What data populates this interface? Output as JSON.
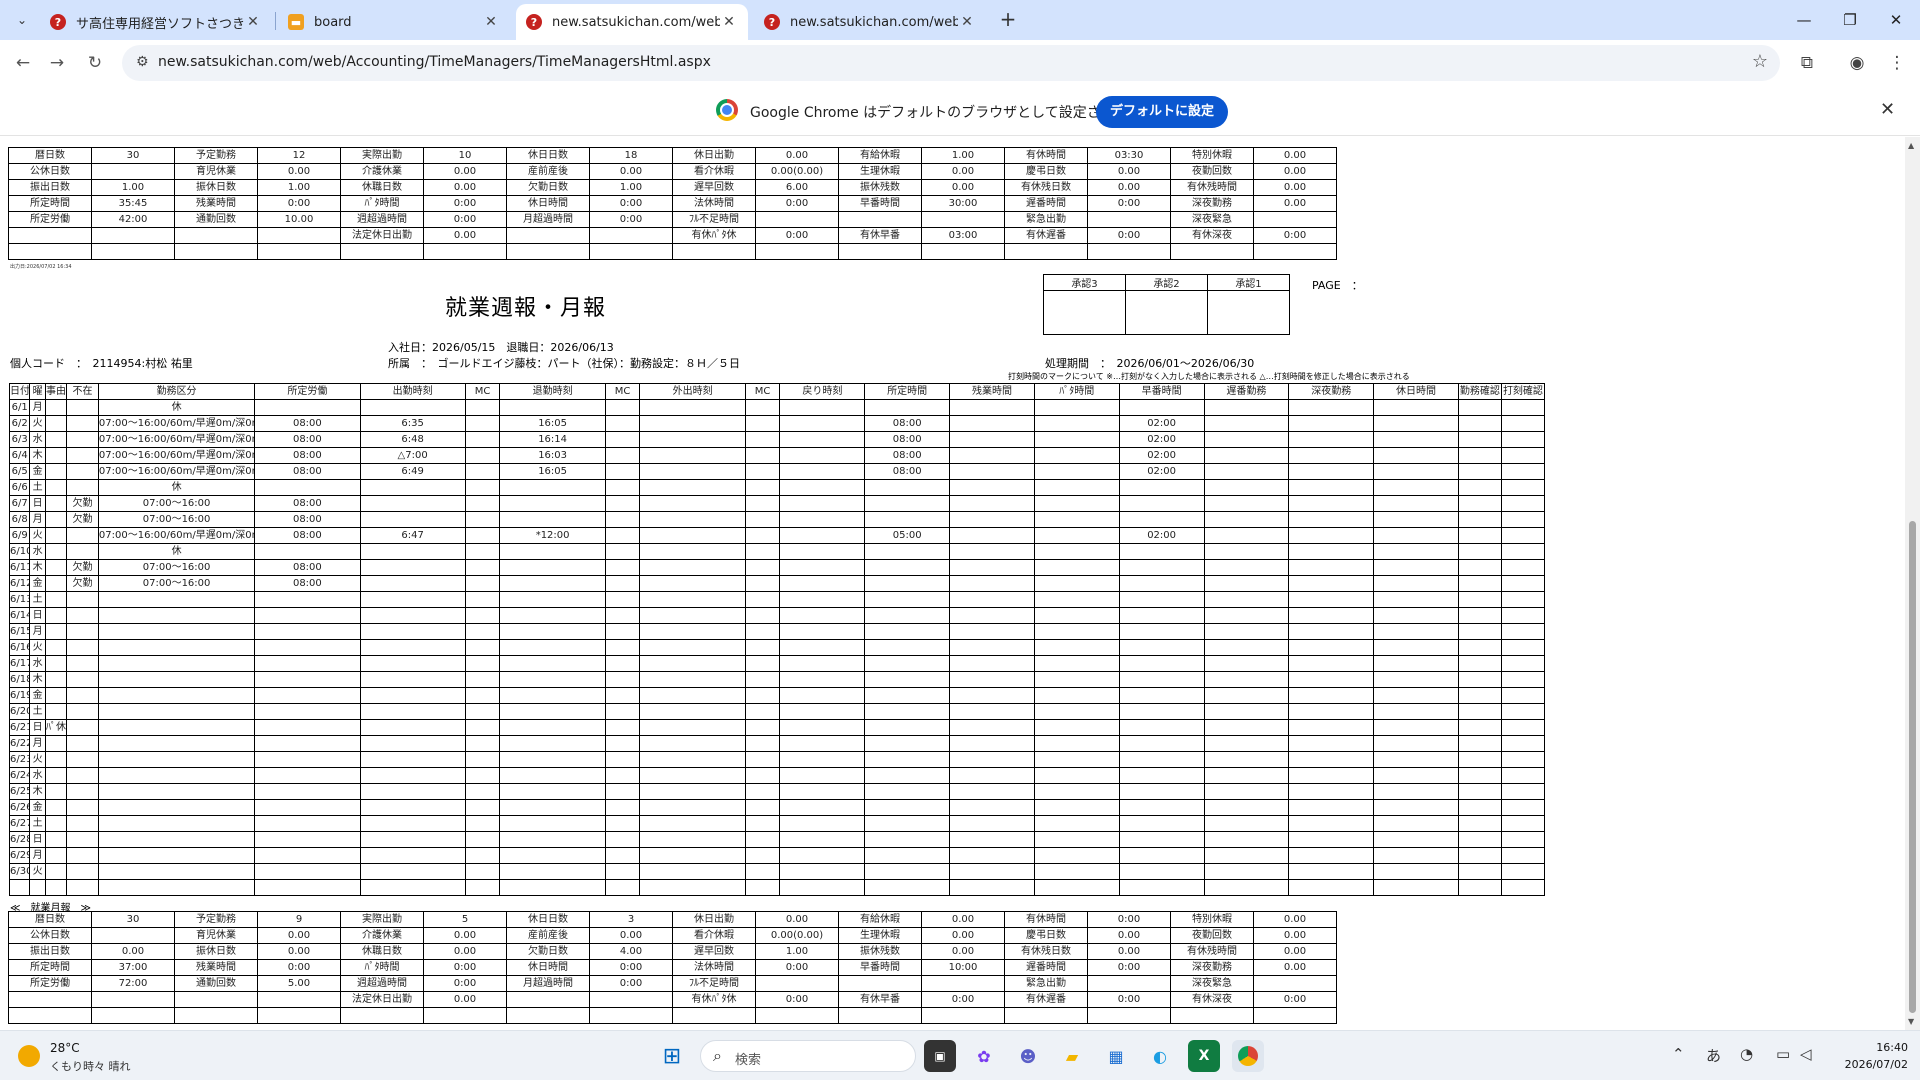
{
  "browser": {
    "tabs": [
      {
        "title": "サ高住専用経営ソフトさつきちゃん",
        "favicon": "question-icon"
      },
      {
        "title": "board",
        "favicon": "board-icon"
      },
      {
        "title": "new.satsukichan.com/web/Acco",
        "favicon": "question-icon"
      },
      {
        "title": "new.satsukichan.com/web/Acco",
        "favicon": "question-icon"
      }
    ],
    "url": "new.satsukichan.com/web/Accounting/TimeManagers/TimeManagersHtml.aspx",
    "infobar_message": "Google Chrome はデフォルトのブラウザとして設定されていません",
    "infobar_button": "デフォルトに設定"
  },
  "top_summary": {
    "rows": [
      [
        "暦日数",
        "30",
        "予定勤務",
        "12",
        "実際出勤",
        "10",
        "休日日数",
        "18",
        "休日出勤",
        "0.00",
        "有給休暇",
        "1.00",
        "有休時間",
        "03:30",
        "特別休暇",
        "0.00"
      ],
      [
        "公休日数",
        "",
        "育児休業",
        "0.00",
        "介護休業",
        "0.00",
        "産前産後",
        "0.00",
        "看介休暇",
        "0.00(0.00)",
        "生理休暇",
        "0.00",
        "慶弔日数",
        "0.00",
        "夜勤回数",
        "0.00"
      ],
      [
        "振出日数",
        "1.00",
        "振休日数",
        "1.00",
        "休職日数",
        "0.00",
        "欠勤日数",
        "1.00",
        "遅早回数",
        "6.00",
        "振休残数",
        "0.00",
        "有休残日数",
        "0.00",
        "有休残時間",
        "0.00"
      ],
      [
        "所定時間",
        "35:45",
        "残業時間",
        "0:00",
        "ﾊﾟﾀ時間",
        "0:00",
        "休日時間",
        "0:00",
        "法休時間",
        "0:00",
        "早番時間",
        "30:00",
        "遅番時間",
        "0:00",
        "深夜勤務",
        "0.00"
      ],
      [
        "所定労働",
        "42:00",
        "通勤回数",
        "10.00",
        "週超過時間",
        "0:00",
        "月超過時間",
        "0:00",
        "ﾌﾙ不足時間",
        "",
        "",
        "",
        "緊急出勤",
        "",
        "深夜緊急",
        ""
      ],
      [
        "",
        "",
        "",
        "",
        "法定休日出勤",
        "0.00",
        "",
        "",
        "有休ﾊﾟﾀ休",
        "0:00",
        "有休早番",
        "03:00",
        "有休遅番",
        "0:00",
        "有休深夜",
        "0:00"
      ],
      [
        "",
        "",
        "",
        "",
        "",
        "",
        "",
        "",
        "",
        "",
        "",
        "",
        "",
        "",
        "",
        ""
      ]
    ]
  },
  "report": {
    "print_stamp": "出力日:2026/07/02 16:34",
    "title": "就業週報・月報",
    "approvals": [
      "承認3",
      "承認2",
      "承認1"
    ],
    "page_label": "PAGE　：",
    "hire_info": "入社日：2026/05/15　退職日：2026/06/13",
    "employee_code": "個人コード　：　2114954:村松 祐里",
    "affiliation": "所属　：　ゴールドエイジ藤枝：パート（社保）：勤務設定：８Ｈ／５日",
    "period": "処理期間　：　2026/06/01〜2026/06/30",
    "mark_note": "打刻時間のマークについて ※…打刻がなく入力した場合に表示される △…打刻時間を修正した場合に表示される"
  },
  "daily": {
    "headers": [
      "日付",
      "曜",
      "事由",
      "不在",
      "勤務区分",
      "所定労働",
      "出勤時刻",
      "MC",
      "退勤時刻",
      "MC",
      "外出時刻",
      "MC",
      "戻り時刻",
      "所定時間",
      "残業時間",
      "ﾊﾟﾀ時間",
      "早番時間",
      "遅番勤務",
      "深夜勤務",
      "休日時間",
      "勤務確認",
      "打刻確認"
    ],
    "rows": [
      [
        "6/1",
        "月",
        "",
        "",
        "休",
        "",
        "",
        "",
        "",
        "",
        "",
        "",
        "",
        "",
        "",
        "",
        "",
        "",
        "",
        "",
        "",
        ""
      ],
      [
        "6/2",
        "火",
        "",
        "",
        "07:00〜16:00/60m/早遅0m/深0m",
        "08:00",
        "6:35",
        "",
        "16:05",
        "",
        "",
        "",
        "",
        "08:00",
        "",
        "",
        "02:00",
        "",
        "",
        "",
        "",
        ""
      ],
      [
        "6/3",
        "水",
        "",
        "",
        "07:00〜16:00/60m/早遅0m/深0m",
        "08:00",
        "6:48",
        "",
        "16:14",
        "",
        "",
        "",
        "",
        "08:00",
        "",
        "",
        "02:00",
        "",
        "",
        "",
        "",
        ""
      ],
      [
        "6/4",
        "木",
        "",
        "",
        "07:00〜16:00/60m/早遅0m/深0m",
        "08:00",
        "△7:00",
        "",
        "16:03",
        "",
        "",
        "",
        "",
        "08:00",
        "",
        "",
        "02:00",
        "",
        "",
        "",
        "",
        ""
      ],
      [
        "6/5",
        "金",
        "",
        "",
        "07:00〜16:00/60m/早遅0m/深0m",
        "08:00",
        "6:49",
        "",
        "16:05",
        "",
        "",
        "",
        "",
        "08:00",
        "",
        "",
        "02:00",
        "",
        "",
        "",
        "",
        ""
      ],
      [
        "6/6",
        "土",
        "",
        "",
        "休",
        "",
        "",
        "",
        "",
        "",
        "",
        "",
        "",
        "",
        "",
        "",
        "",
        "",
        "",
        "",
        "",
        ""
      ],
      [
        "6/7",
        "日",
        "",
        "欠勤",
        "07:00〜16:00",
        "08:00",
        "",
        "",
        "",
        "",
        "",
        "",
        "",
        "",
        "",
        "",
        "",
        "",
        "",
        "",
        "",
        ""
      ],
      [
        "6/8",
        "月",
        "",
        "欠勤",
        "07:00〜16:00",
        "08:00",
        "",
        "",
        "",
        "",
        "",
        "",
        "",
        "",
        "",
        "",
        "",
        "",
        "",
        "",
        "",
        ""
      ],
      [
        "6/9",
        "火",
        "",
        "",
        "07:00〜16:00/60m/早遅0m/深0m",
        "08:00",
        "6:47",
        "",
        "*12:00",
        "",
        "",
        "",
        "",
        "05:00",
        "",
        "",
        "02:00",
        "",
        "",
        "",
        "",
        ""
      ],
      [
        "6/10",
        "水",
        "",
        "",
        "休",
        "",
        "",
        "",
        "",
        "",
        "",
        "",
        "",
        "",
        "",
        "",
        "",
        "",
        "",
        "",
        "",
        ""
      ],
      [
        "6/11",
        "木",
        "",
        "欠勤",
        "07:00〜16:00",
        "08:00",
        "",
        "",
        "",
        "",
        "",
        "",
        "",
        "",
        "",
        "",
        "",
        "",
        "",
        "",
        "",
        ""
      ],
      [
        "6/12",
        "金",
        "",
        "欠勤",
        "07:00〜16:00",
        "08:00",
        "",
        "",
        "",
        "",
        "",
        "",
        "",
        "",
        "",
        "",
        "",
        "",
        "",
        "",
        "",
        ""
      ],
      [
        "6/13",
        "土",
        "",
        "",
        "",
        "",
        "",
        "",
        "",
        "",
        "",
        "",
        "",
        "",
        "",
        "",
        "",
        "",
        "",
        "",
        "",
        ""
      ],
      [
        "6/14",
        "日",
        "",
        "",
        "",
        "",
        "",
        "",
        "",
        "",
        "",
        "",
        "",
        "",
        "",
        "",
        "",
        "",
        "",
        "",
        "",
        ""
      ],
      [
        "6/15",
        "月",
        "",
        "",
        "",
        "",
        "",
        "",
        "",
        "",
        "",
        "",
        "",
        "",
        "",
        "",
        "",
        "",
        "",
        "",
        "",
        ""
      ],
      [
        "6/16",
        "火",
        "",
        "",
        "",
        "",
        "",
        "",
        "",
        "",
        "",
        "",
        "",
        "",
        "",
        "",
        "",
        "",
        "",
        "",
        "",
        ""
      ],
      [
        "6/17",
        "水",
        "",
        "",
        "",
        "",
        "",
        "",
        "",
        "",
        "",
        "",
        "",
        "",
        "",
        "",
        "",
        "",
        "",
        "",
        "",
        ""
      ],
      [
        "6/18",
        "木",
        "",
        "",
        "",
        "",
        "",
        "",
        "",
        "",
        "",
        "",
        "",
        "",
        "",
        "",
        "",
        "",
        "",
        "",
        "",
        ""
      ],
      [
        "6/19",
        "金",
        "",
        "",
        "",
        "",
        "",
        "",
        "",
        "",
        "",
        "",
        "",
        "",
        "",
        "",
        "",
        "",
        "",
        "",
        "",
        ""
      ],
      [
        "6/20",
        "土",
        "",
        "",
        "",
        "",
        "",
        "",
        "",
        "",
        "",
        "",
        "",
        "",
        "",
        "",
        "",
        "",
        "",
        "",
        "",
        ""
      ],
      [
        "6/21",
        "日",
        "ﾊﾟ休",
        "",
        "",
        "",
        "",
        "",
        "",
        "",
        "",
        "",
        "",
        "",
        "",
        "",
        "",
        "",
        "",
        "",
        "",
        ""
      ],
      [
        "6/22",
        "月",
        "",
        "",
        "",
        "",
        "",
        "",
        "",
        "",
        "",
        "",
        "",
        "",
        "",
        "",
        "",
        "",
        "",
        "",
        "",
        ""
      ],
      [
        "6/23",
        "火",
        "",
        "",
        "",
        "",
        "",
        "",
        "",
        "",
        "",
        "",
        "",
        "",
        "",
        "",
        "",
        "",
        "",
        "",
        "",
        ""
      ],
      [
        "6/24",
        "水",
        "",
        "",
        "",
        "",
        "",
        "",
        "",
        "",
        "",
        "",
        "",
        "",
        "",
        "",
        "",
        "",
        "",
        "",
        "",
        ""
      ],
      [
        "6/25",
        "木",
        "",
        "",
        "",
        "",
        "",
        "",
        "",
        "",
        "",
        "",
        "",
        "",
        "",
        "",
        "",
        "",
        "",
        "",
        "",
        ""
      ],
      [
        "6/26",
        "金",
        "",
        "",
        "",
        "",
        "",
        "",
        "",
        "",
        "",
        "",
        "",
        "",
        "",
        "",
        "",
        "",
        "",
        "",
        "",
        ""
      ],
      [
        "6/27",
        "土",
        "",
        "",
        "",
        "",
        "",
        "",
        "",
        "",
        "",
        "",
        "",
        "",
        "",
        "",
        "",
        "",
        "",
        "",
        "",
        ""
      ],
      [
        "6/28",
        "日",
        "",
        "",
        "",
        "",
        "",
        "",
        "",
        "",
        "",
        "",
        "",
        "",
        "",
        "",
        "",
        "",
        "",
        "",
        "",
        ""
      ],
      [
        "6/29",
        "月",
        "",
        "",
        "",
        "",
        "",
        "",
        "",
        "",
        "",
        "",
        "",
        "",
        "",
        "",
        "",
        "",
        "",
        "",
        "",
        ""
      ],
      [
        "6/30",
        "火",
        "",
        "",
        "",
        "",
        "",
        "",
        "",
        "",
        "",
        "",
        "",
        "",
        "",
        "",
        "",
        "",
        "",
        "",
        "",
        ""
      ],
      [
        "",
        "",
        "",
        "",
        "",
        "",
        "",
        "",
        "",
        "",
        "",
        "",
        "",
        "",
        "",
        "",
        "",
        "",
        "",
        "",
        "",
        ""
      ]
    ]
  },
  "monthly": {
    "label": "≪　就業月報　≫",
    "rows": [
      [
        "暦日数",
        "30",
        "予定勤務",
        "9",
        "実際出勤",
        "5",
        "休日日数",
        "3",
        "休日出勤",
        "0.00",
        "有給休暇",
        "0.00",
        "有休時間",
        "0:00",
        "特別休暇",
        "0.00"
      ],
      [
        "公休日数",
        "",
        "育児休業",
        "0.00",
        "介護休業",
        "0.00",
        "産前産後",
        "0.00",
        "看介休暇",
        "0.00(0.00)",
        "生理休暇",
        "0.00",
        "慶弔日数",
        "0.00",
        "夜勤回数",
        "0.00"
      ],
      [
        "振出日数",
        "0.00",
        "振休日数",
        "0.00",
        "休職日数",
        "0.00",
        "欠勤日数",
        "4.00",
        "遅早回数",
        "1.00",
        "振休残数",
        "0.00",
        "有休残日数",
        "0.00",
        "有休残時間",
        "0.00"
      ],
      [
        "所定時間",
        "37:00",
        "残業時間",
        "0:00",
        "ﾊﾟﾀ時間",
        "0:00",
        "休日時間",
        "0:00",
        "法休時間",
        "0:00",
        "早番時間",
        "10:00",
        "遅番時間",
        "0:00",
        "深夜勤務",
        "0.00"
      ],
      [
        "所定労働",
        "72:00",
        "通勤回数",
        "5.00",
        "週超過時間",
        "0:00",
        "月超過時間",
        "0:00",
        "ﾌﾙ不足時間",
        "",
        "",
        "",
        "緊急出勤",
        "",
        "深夜緊急",
        ""
      ],
      [
        "",
        "",
        "",
        "",
        "法定休日出勤",
        "0.00",
        "",
        "",
        "有休ﾊﾟﾀ休",
        "0:00",
        "有休早番",
        "0:00",
        "有休遅番",
        "0:00",
        "有休深夜",
        "0:00"
      ],
      [
        "",
        "",
        "",
        "",
        "",
        "",
        "",
        "",
        "",
        "",
        "",
        "",
        "",
        "",
        "",
        ""
      ]
    ]
  },
  "taskbar": {
    "temp": "28°C",
    "weather": "くもり時々 晴れ",
    "search_placeholder": "検索",
    "time": "16:40",
    "date": "2026/07/02"
  }
}
